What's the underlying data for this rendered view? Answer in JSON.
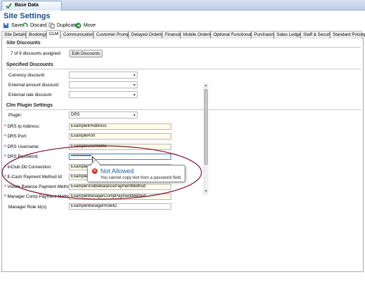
{
  "window": {
    "doc_tab": "Base Data"
  },
  "page": {
    "title": "Site Settings"
  },
  "toolbar": {
    "save": "Save",
    "discard": "Discard",
    "duplicate": "Duplicate",
    "move": "Move"
  },
  "tabs": [
    "Site Details",
    "Bookings",
    "CLM",
    "Communications",
    "Customer Prompts",
    "Delayed Ordering",
    "Finance",
    "Mobile Ordering",
    "Optional Functionality",
    "Purchasing",
    "Sales Ledger",
    "Staff & Security",
    "Standard Pricing"
  ],
  "active_tab": "CLM",
  "site_discounts": {
    "heading": "Site Discounts",
    "assigned_text": "7 of 9 discounts assigned",
    "edit_button": "Edit Discounts"
  },
  "specified_discounts": {
    "heading": "Specified Discounts",
    "currency_label": "Currency discount:",
    "external_amount_label": "External amount discount:",
    "external_rate_label": "External rate discount:"
  },
  "clm_plugin": {
    "heading": "Clm Plugin Settings",
    "plugin_label": "Plugin:",
    "plugin_value": "DRS",
    "fields": {
      "ip_label": "DRS Ip Address:",
      "ip_value": "ExampleIPAddress",
      "port_label": "DRS Port:",
      "port_value": "ExamplePort",
      "username_label": "DRS Username:",
      "username_value": "ExampleUsername",
      "password_label": "DRS Password:",
      "password_value": "••••••••••••••",
      "inclub_label": "InClub Db Connection:",
      "inclub_value": "ExampleDb",
      "ecash_label": "E-Cash Payment Method Id:",
      "ecash_value": "ExampleE",
      "visible_balance_label": "Visible Balance Payment Method",
      "visible_balance_value": "ExampleVisibleBalancePaymentMethod",
      "manager_comp_label": "Manager Comp Payment Method",
      "manager_comp_value": "ExampleManagerCompPaymentMethod",
      "manager_role_label": "Manager Role Id(s):",
      "manager_role_value": "ExampleManagerRoleID"
    }
  },
  "tooltip": {
    "title": "Not Allowed",
    "message": "You cannot copy text from a password field."
  },
  "colors": {
    "title_blue": "#1f4e8c",
    "required_red": "#d9261c",
    "field_yellow": "#fffde9",
    "annotation_ellipse": "#7a1030"
  }
}
